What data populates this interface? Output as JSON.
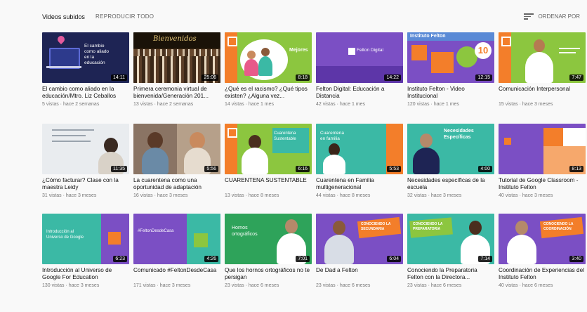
{
  "header": {
    "section_title": "Videos subidos",
    "play_all": "REPRODUCIR TODO",
    "sort_label": "ORDENAR POR"
  },
  "videos": [
    {
      "title": "El cambio como aliado en la educación/Mtro. Liz Ceballos",
      "meta": "5 vistas · hace 2 semanas",
      "duration": "14:11"
    },
    {
      "title": "Primera ceremonia virtual de bienvenida/Generación 201...",
      "meta": "13 vistas · hace 2 semanas",
      "duration": "25:06"
    },
    {
      "title": "¿Qué es el racismo? ¿Qué tipos existen? ¿Alguna vez...",
      "meta": "14 vistas · hace 1 mes",
      "duration": "8:18"
    },
    {
      "title": "Felton Digital: Educación a Distancia",
      "meta": "42 vistas · hace 1 mes",
      "duration": "14:22"
    },
    {
      "title": "Instituto Felton - Video Institucional",
      "meta": "120 vistas · hace 1 mes",
      "duration": "12:15"
    },
    {
      "title": "Comunicación Interpersonal",
      "meta": "15 vistas · hace 3 meses",
      "duration": "7:47"
    },
    {
      "title": "¿Cómo facturar? Clase con la maestra Leidy",
      "meta": "31 vistas · hace 3 meses",
      "duration": "11:35"
    },
    {
      "title": "La cuarentena como una oportunidad de adaptación",
      "meta": "16 vistas · hace 3 meses",
      "duration": "5:56"
    },
    {
      "title": "CUARENTENA SUSTENTABLE",
      "meta": "13 vistas · hace 8 meses",
      "duration": "6:16"
    },
    {
      "title": "Cuarentena en Familia multigeneracional",
      "meta": "44 vistas · hace 8 meses",
      "duration": "5:53"
    },
    {
      "title": "Necesidades específicas de la escuela",
      "meta": "32 vistas · hace 3 meses",
      "duration": "4:00"
    },
    {
      "title": "Tutorial de Google Classroom - Instituto Felton",
      "meta": "40 vistas · hace 3 meses",
      "duration": "8:13"
    },
    {
      "title": "Introducción al Universo de Google For Education",
      "meta": "130 vistas · hace 3 meses",
      "duration": "6:23"
    },
    {
      "title": "Comunicado #FeltonDesdeCasa",
      "meta": "171 vistas · hace 3 meses",
      "duration": "4:26"
    },
    {
      "title": "Que los hornos ortográficos no te persigan",
      "meta": "23 vistas · hace 6 meses",
      "duration": "7:01"
    },
    {
      "title": "De Dad a Felton",
      "meta": "23 vistas · hace 6 meses",
      "duration": "6:04"
    },
    {
      "title": "Conociendo la Preparatoria Felton con la Directora...",
      "meta": "23 vistas · hace 6 meses",
      "duration": "7:14"
    },
    {
      "title": "Coordinación de Experiencias del Instituto Felton",
      "meta": "40 vistas · hace 6 meses",
      "duration": "3:40"
    }
  ],
  "thumb_text": {
    "v1_line1": "El cambio",
    "v1_line2": "como aliado",
    "v1_line3": "en la",
    "v1_line4": "educación",
    "v2_line1": "Bienvenidos",
    "v3_line1": "Mejores",
    "v4_line1": "Felton Digital",
    "v5_line1": "Instituto Felton",
    "v5_badge": "10",
    "v9_line1": "Cuarentena",
    "v9_line2": "Sustentable",
    "v10_line1": "Cuarentena",
    "v10_line2": "en familia",
    "v11_line1": "Necesidades",
    "v11_line2": "Específicas",
    "v13_line1": "Introducción al",
    "v13_line2": "Universo de Google",
    "v14_line1": "#FeltonDesdeCasa",
    "v15_line1": "Hornos",
    "v15_line2": "ortográficos",
    "v16_line1": "CONOCIENDO LA",
    "v16_line2": "SECUNDARIA",
    "v17_line1": "CONOCIENDO LA",
    "v17_line2": "PREPARATORIA",
    "v18_line1": "CONOCIENDO LA",
    "v18_line2": "COORDINACIÓN"
  },
  "colors": {
    "purple": "#7b4fc4",
    "green": "#8cc63f",
    "teal": "#3bb9a5",
    "orange": "#f37e2a",
    "navy": "#1e2454"
  }
}
